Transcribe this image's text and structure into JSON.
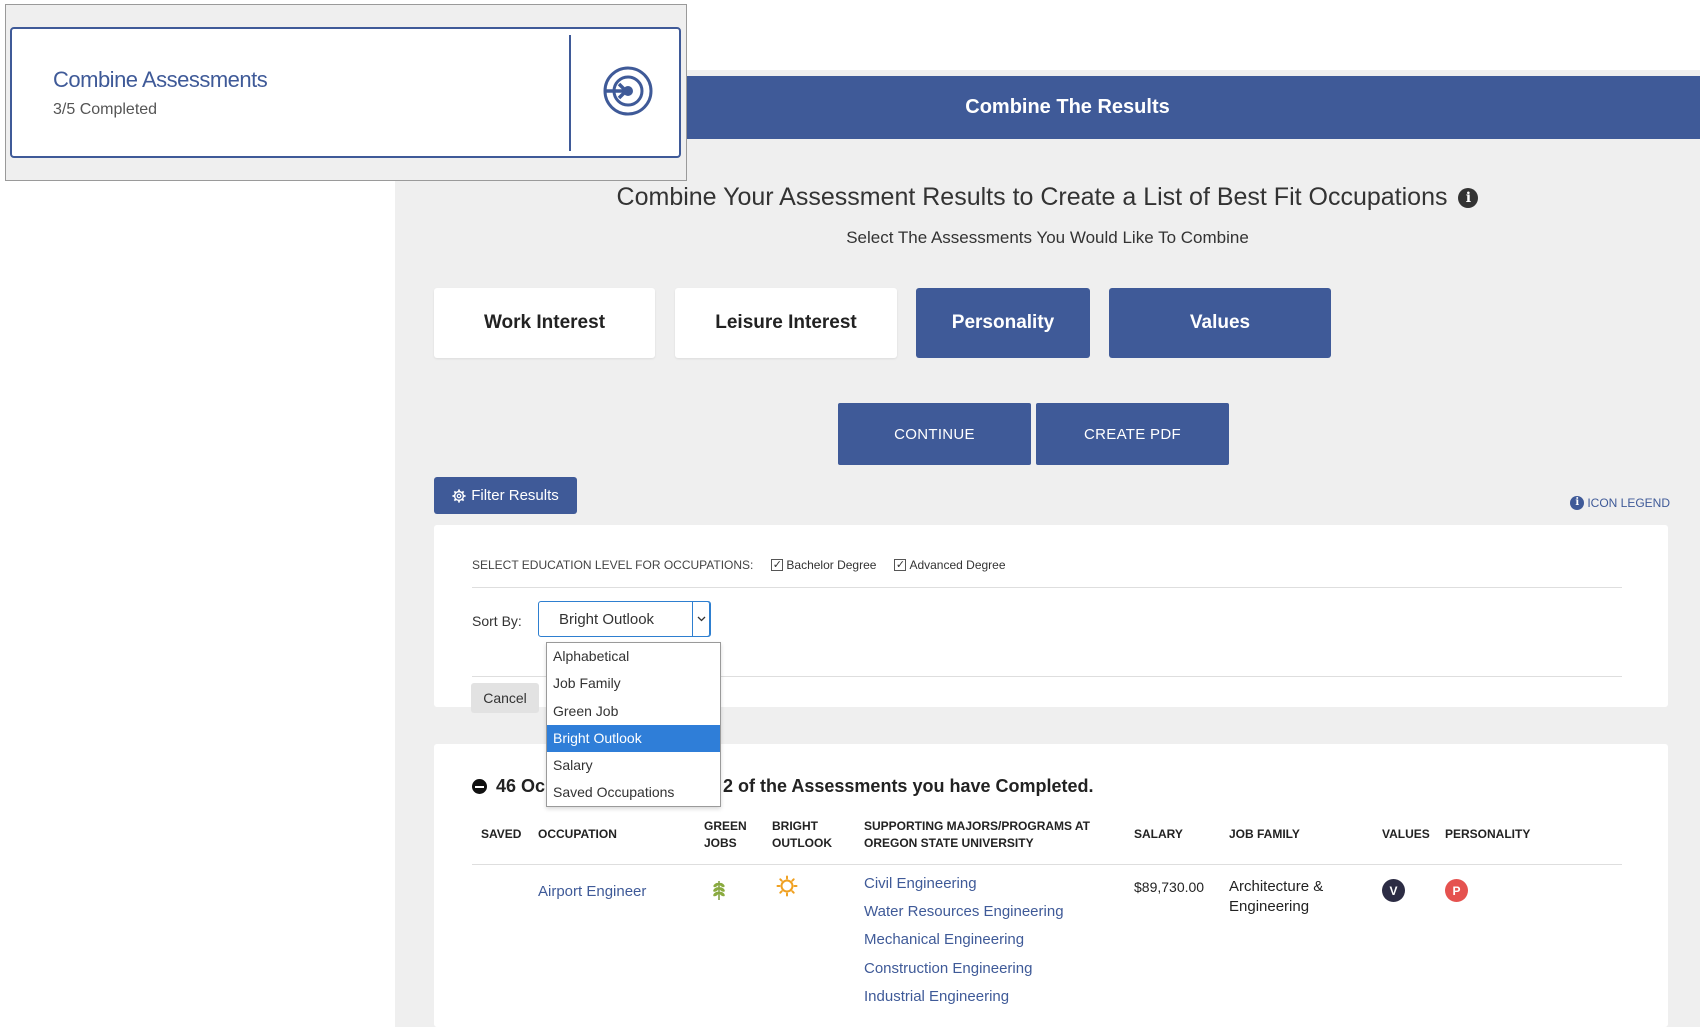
{
  "overlay": {
    "title": "Combine Assessments",
    "progress": "3/5 Completed",
    "icon": "target-arrow-icon"
  },
  "header": {
    "title": "Combine The Results"
  },
  "intro": {
    "title": "Combine Your Assessment Results to Create a List of Best Fit Occupations",
    "info_glyph": "i",
    "subtitle": "Select The Assessments You Would Like To Combine"
  },
  "assessments": [
    {
      "label": "Work Interest",
      "selected": false
    },
    {
      "label": "Leisure Interest",
      "selected": false
    },
    {
      "label": "Personality",
      "selected": true
    },
    {
      "label": "Values",
      "selected": true
    }
  ],
  "actions": {
    "continue": "CONTINUE",
    "create_pdf": "CREATE PDF"
  },
  "filter": {
    "button": "Filter Results",
    "legend": "ICON LEGEND",
    "education_label": "SELECT EDUCATION LEVEL FOR OCCUPATIONS:",
    "education_options": [
      {
        "label": "Bachelor Degree",
        "checked": true
      },
      {
        "label": "Advanced Degree",
        "checked": true
      }
    ],
    "sort_label": "Sort By:",
    "sort_value": "Bright Outlook",
    "sort_options": [
      "Alphabetical",
      "Job Family",
      "Green Job",
      "Bright Outlook",
      "Salary",
      "Saved Occupations"
    ],
    "cancel": "Cancel"
  },
  "results": {
    "heading_start": "46 Oc",
    "heading_end": "n 2 of the Assessments you have Completed.",
    "columns": {
      "saved": "SAVED",
      "occupation": "OCCUPATION",
      "green_1": "GREEN",
      "green_2": "JOBS",
      "bright_1": "BRIGHT",
      "bright_2": "OUTLOOK",
      "majors_1": "SUPPORTING MAJORS/PROGRAMS AT",
      "majors_2": "OREGON STATE UNIVERSITY",
      "salary": "SALARY",
      "job_family": "JOB FAMILY",
      "values": "VALUES",
      "personality": "PERSONALITY"
    },
    "rows": [
      {
        "occupation": "Airport Engineer",
        "green_icon": "leaf-icon",
        "bright_icon": "sun-icon",
        "majors": [
          "Civil Engineering",
          "Water Resources Engineering",
          "Mechanical Engineering",
          "Construction Engineering",
          "Industrial Engineering"
        ],
        "salary": "$89,730.00",
        "job_family_1": "Architecture &",
        "job_family_2": "Engineering",
        "values_badge": "V",
        "personality_badge": "P"
      }
    ]
  },
  "colors": {
    "primary": "#3f5a98",
    "panel": "#efefef",
    "select_highlight": "#2f7ed8",
    "green_icon": "#7a9a3a",
    "sun_icon": "#f0a020",
    "values_badge": "#2c2c44",
    "personality_badge": "#e5524f"
  }
}
